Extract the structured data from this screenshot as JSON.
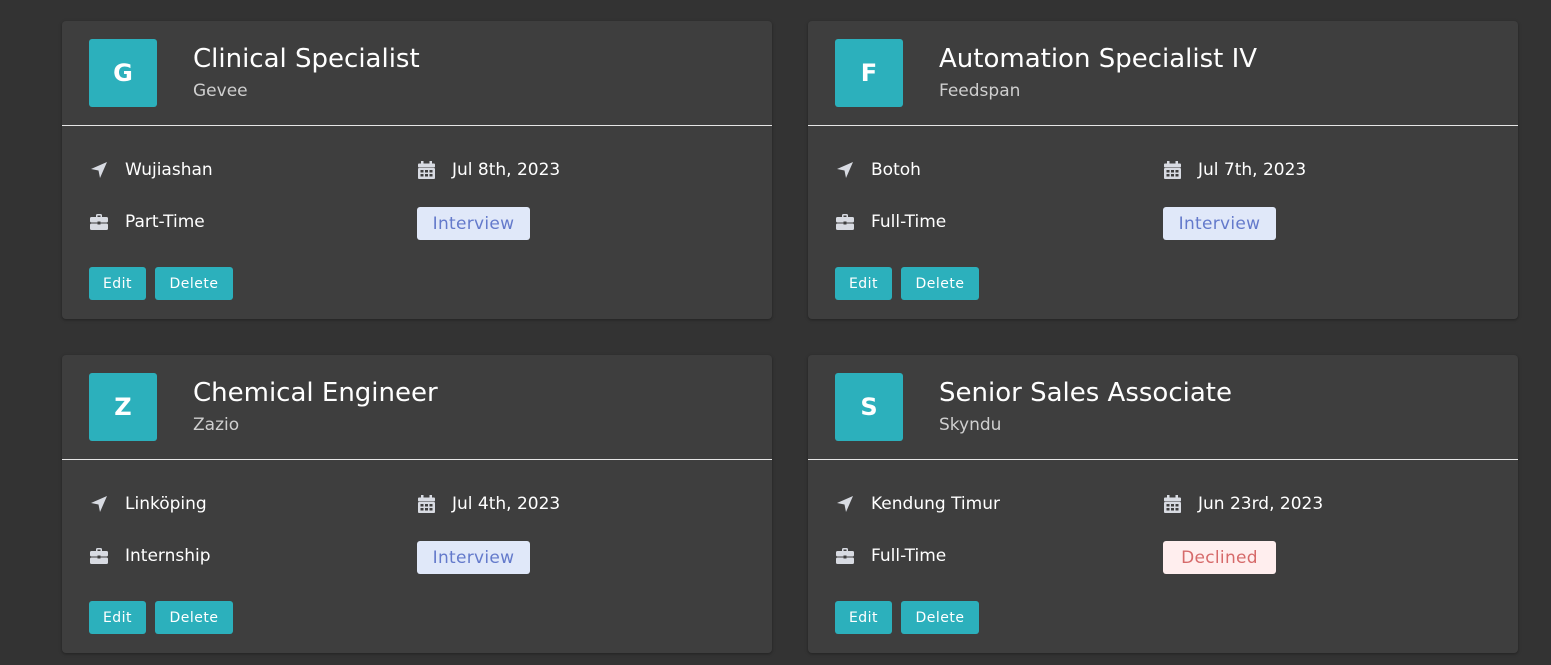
{
  "colors": {
    "background": "#333333",
    "card": "#3e3e3e",
    "accent": "#2cb0bc",
    "interview_bg": "#e0e8f9",
    "interview_text": "#647acb",
    "declined_bg": "#ffeeee",
    "declined_text": "#d66a6a"
  },
  "icons": {
    "location": "location-arrow-icon",
    "date": "calendar-icon",
    "job_type": "briefcase-icon"
  },
  "jobs": [
    {
      "initial": "G",
      "position": "Clinical Specialist",
      "company": "Gevee",
      "location": "Wujiashan",
      "date": "Jul 8th, 2023",
      "job_type": "Part-Time",
      "status": "Interview",
      "status_kind": "interview",
      "edit_label": "Edit",
      "delete_label": "Delete"
    },
    {
      "initial": "F",
      "position": "Automation Specialist IV",
      "company": "Feedspan",
      "location": "Botoh",
      "date": "Jul 7th, 2023",
      "job_type": "Full-Time",
      "status": "Interview",
      "status_kind": "interview",
      "edit_label": "Edit",
      "delete_label": "Delete"
    },
    {
      "initial": "Z",
      "position": "Chemical Engineer",
      "company": "Zazio",
      "location": "Linköping",
      "date": "Jul 4th, 2023",
      "job_type": "Internship",
      "status": "Interview",
      "status_kind": "interview",
      "edit_label": "Edit",
      "delete_label": "Delete"
    },
    {
      "initial": "S",
      "position": "Senior Sales Associate",
      "company": "Skyndu",
      "location": "Kendung Timur",
      "date": "Jun 23rd, 2023",
      "job_type": "Full-Time",
      "status": "Declined",
      "status_kind": "declined",
      "edit_label": "Edit",
      "delete_label": "Delete"
    }
  ]
}
